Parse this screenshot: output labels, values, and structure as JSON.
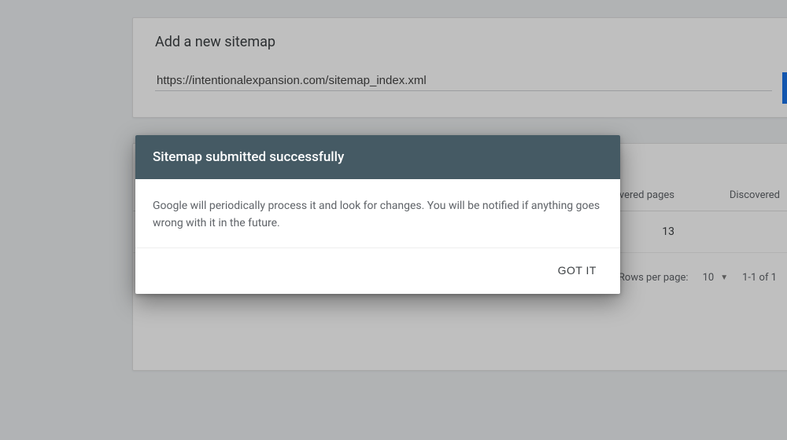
{
  "add_sitemap": {
    "title": "Add a new sitemap",
    "url_value": "https://intentionalexpansion.com/sitemap_index.xml"
  },
  "table": {
    "col_discovered_pages": "iscovered pages",
    "col_discovered": "Discovered",
    "row1_discovered_pages": "13",
    "pager_label": "Rows per page:",
    "pager_size": "10",
    "pager_range": "1-1 of 1"
  },
  "dialog": {
    "title": "Sitemap submitted successfully",
    "body": "Google will periodically process it and look for changes. You will be notified if anything goes wrong with it in the future.",
    "confirm": "GOT IT"
  }
}
